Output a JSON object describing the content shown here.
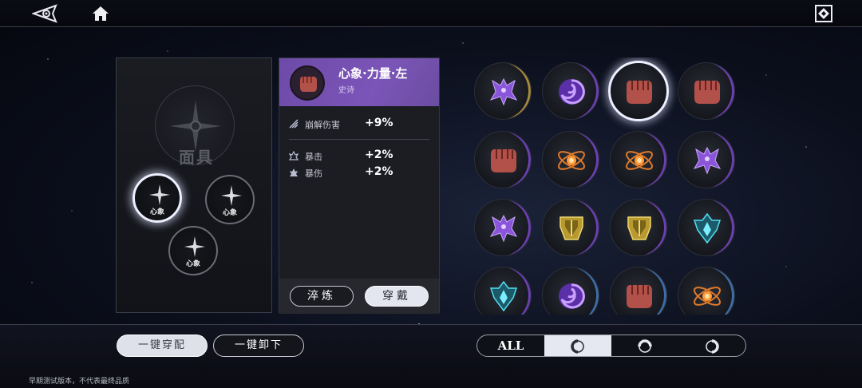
{
  "topbar": {
    "logo_icon": "eye-logo-icon",
    "home_icon": "home-icon",
    "menu_icon": "diamond-menu-icon"
  },
  "mask_panel": {
    "mask_label": "面具",
    "slots": [
      {
        "label": "心象",
        "active": true
      },
      {
        "label": "心象",
        "active": false
      },
      {
        "label": "心象",
        "active": false
      }
    ]
  },
  "detail": {
    "title": "心象·力量·左",
    "rarity": "史诗",
    "stats": [
      {
        "name": "崩解伤害",
        "value": "+9%"
      },
      {
        "name": "暴击",
        "value": "+2%"
      },
      {
        "name": "暴伤",
        "value": "+2%"
      }
    ],
    "refine_label": "淬炼",
    "equip_label": "穿戴"
  },
  "grid": {
    "items": [
      {
        "icon": "purple-moth-icon",
        "rarity": "gold"
      },
      {
        "icon": "purple-vortex-icon",
        "rarity": "purple"
      },
      {
        "icon": "red-fist-icon",
        "rarity": "purple",
        "selected": true
      },
      {
        "icon": "red-fist-icon",
        "rarity": "purple"
      },
      {
        "icon": "red-fist-icon",
        "rarity": "purple"
      },
      {
        "icon": "orange-atom-icon",
        "rarity": "purple"
      },
      {
        "icon": "orange-atom-icon",
        "rarity": "purple"
      },
      {
        "icon": "purple-moth-icon",
        "rarity": "purple"
      },
      {
        "icon": "purple-moth-icon",
        "rarity": "purple"
      },
      {
        "icon": "gold-shield-icon",
        "rarity": "purple"
      },
      {
        "icon": "gold-shield-icon",
        "rarity": "purple"
      },
      {
        "icon": "cyan-crest-icon",
        "rarity": "purple"
      },
      {
        "icon": "cyan-crest-icon",
        "rarity": "purple"
      },
      {
        "icon": "purple-vortex-icon",
        "rarity": "blue"
      },
      {
        "icon": "red-fist-icon",
        "rarity": "blue"
      },
      {
        "icon": "orange-atom-icon",
        "rarity": "blue"
      }
    ]
  },
  "bottom": {
    "equip_all_label": "一键穿配",
    "unequip_all_label": "一键卸下",
    "filter_all_label": "ALL",
    "filter_tabs": [
      "left-ring-icon",
      "top-ring-icon",
      "right-ring-icon"
    ],
    "filter_selected": 1,
    "disclaimer": "早期测试版本，不代表最终品质"
  },
  "colors": {
    "epic_purple": "#7b55b8",
    "selection_glow": "#eef0ff",
    "panel_bg": "#1b1d23"
  }
}
